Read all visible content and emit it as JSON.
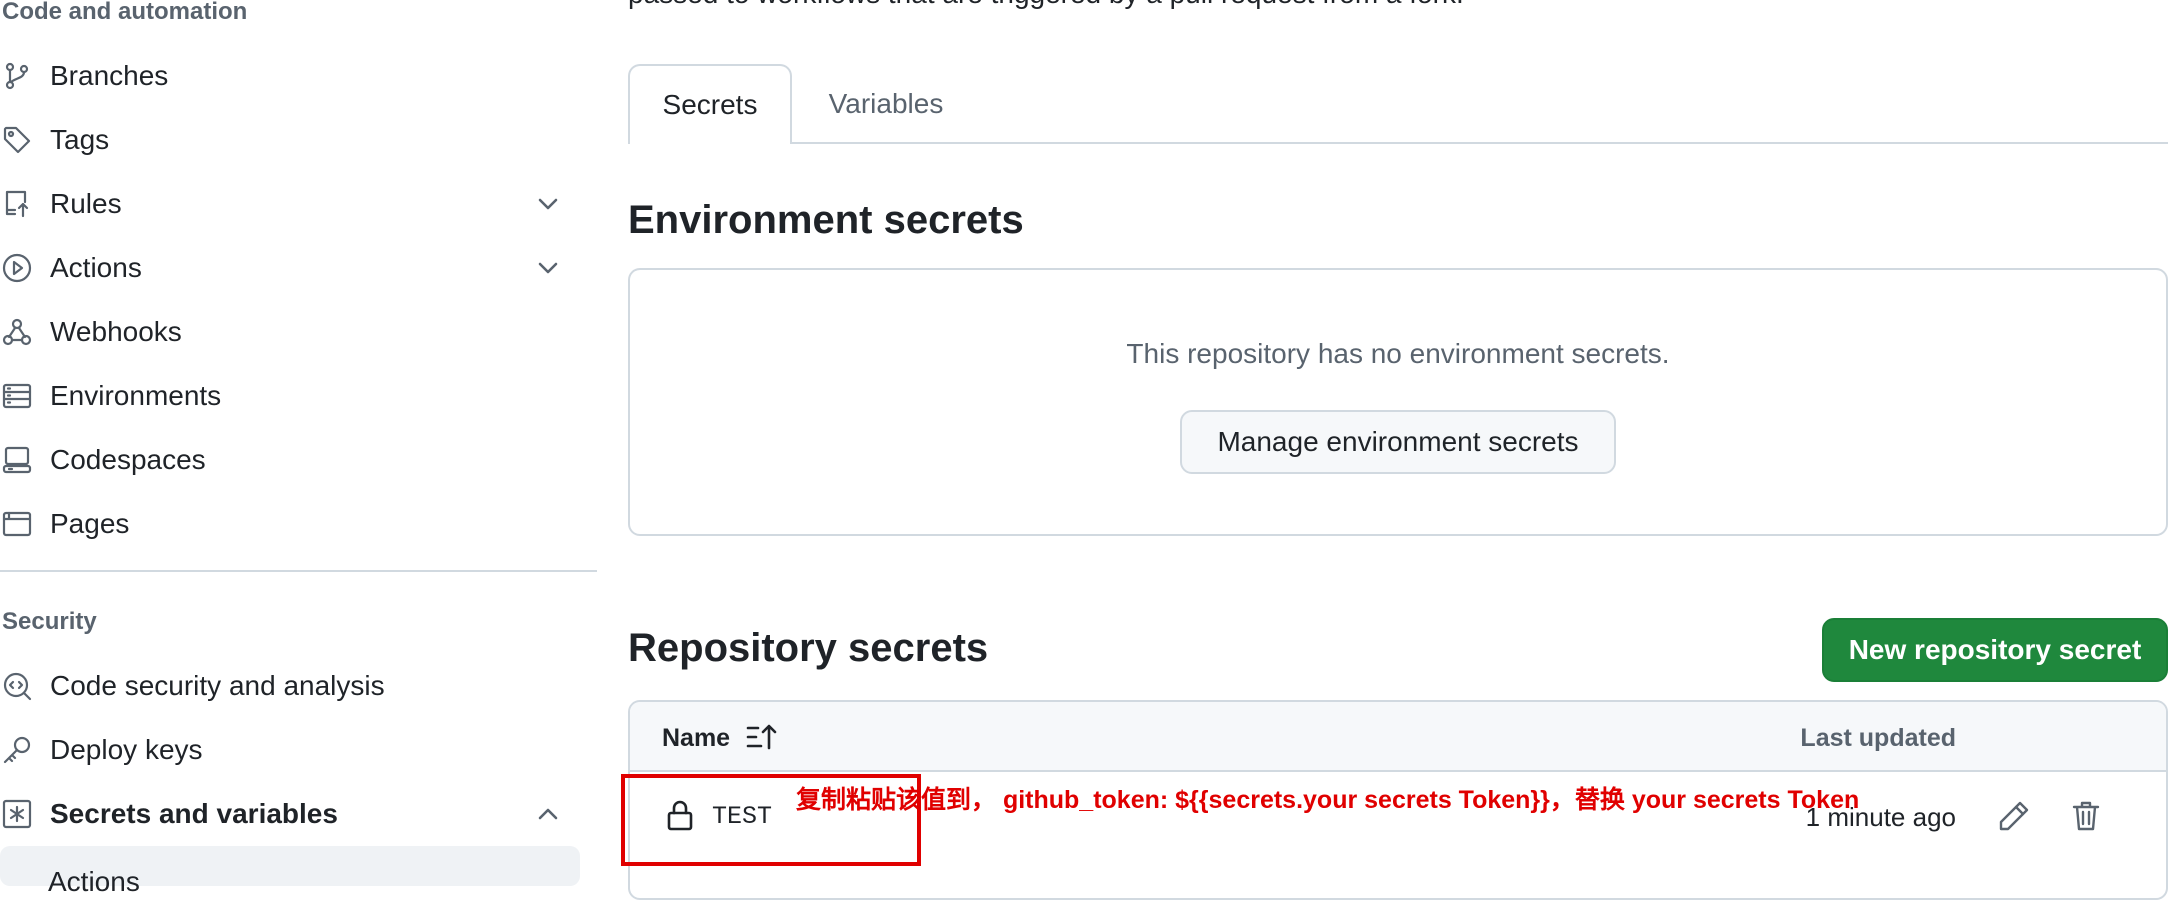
{
  "sidebar": {
    "code_heading": "Code and automation",
    "items": [
      {
        "label": "Branches",
        "icon": "git-branch-icon"
      },
      {
        "label": "Tags",
        "icon": "tag-icon"
      },
      {
        "label": "Rules",
        "icon": "repo-push-icon",
        "expandable": true
      },
      {
        "label": "Actions",
        "icon": "play-icon",
        "expandable": true
      },
      {
        "label": "Webhooks",
        "icon": "webhook-icon"
      },
      {
        "label": "Environments",
        "icon": "server-icon"
      },
      {
        "label": "Codespaces",
        "icon": "codespaces-icon"
      },
      {
        "label": "Pages",
        "icon": "browser-icon"
      }
    ],
    "security_heading": "Security",
    "security_items": [
      {
        "label": "Code security and analysis",
        "icon": "codescan-icon"
      },
      {
        "label": "Deploy keys",
        "icon": "key-icon"
      },
      {
        "label": "Secrets and variables",
        "icon": "asterisk-icon",
        "expanded": true
      }
    ],
    "sub_item": "Actions"
  },
  "main": {
    "intro_text": "passed to workflows that are triggered by a pull request from a fork.",
    "tabs": [
      {
        "label": "Secrets",
        "active": true
      },
      {
        "label": "Variables",
        "active": false
      }
    ],
    "env": {
      "title": "Environment secrets",
      "empty_text": "This repository has no environment secrets.",
      "manage_button": "Manage environment secrets"
    },
    "repo": {
      "title": "Repository secrets",
      "new_button": "New repository secret",
      "col_name": "Name",
      "col_updated": "Last updated",
      "rows": [
        {
          "name": "TEST",
          "updated": "1 minute ago"
        }
      ]
    }
  },
  "annotation": {
    "text": "复制粘贴该值到， github_token: ${{secrets.your secrets Token}}，替换 your secrets Token",
    "color": "#e00000"
  },
  "colors": {
    "primary_button": "#1f883d",
    "border": "#d1d9e0",
    "muted_text": "#59636e"
  }
}
